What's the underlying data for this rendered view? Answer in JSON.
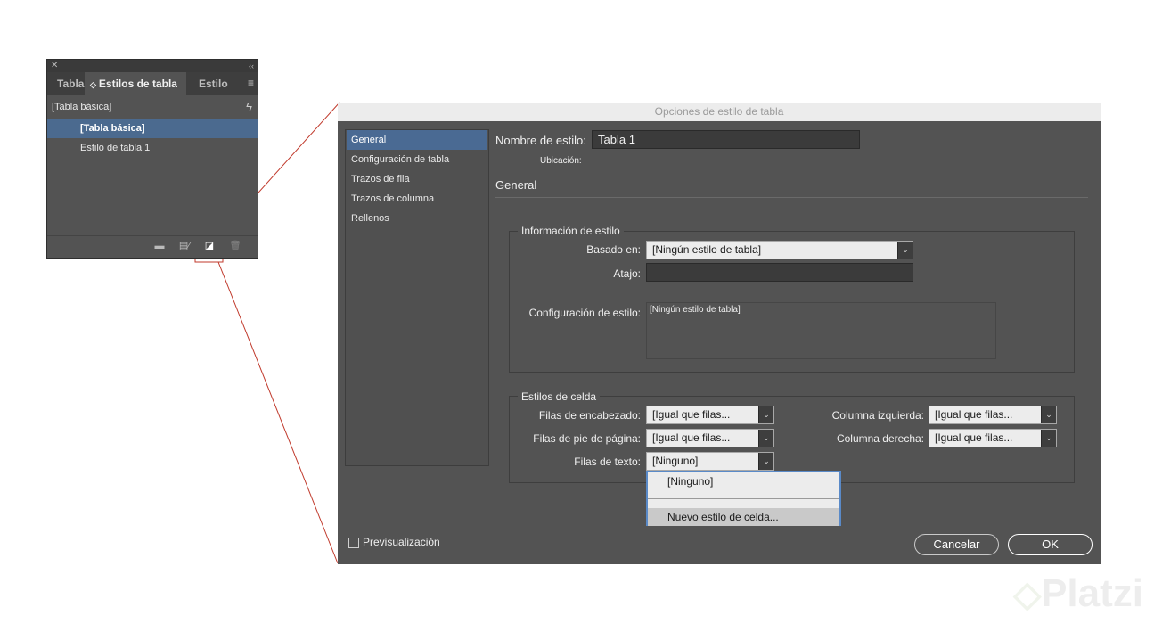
{
  "panel": {
    "tabs": [
      "Tabla",
      "Estilos de tabla",
      "Estilo"
    ],
    "active_tab_marker": "◇",
    "current_style": "[Tabla básica]",
    "styles": [
      "[Tabla básica]",
      "Estilo de tabla 1"
    ]
  },
  "dialog": {
    "title": "Opciones de estilo de tabla",
    "sidebar": [
      "General",
      "Configuración de tabla",
      "Trazos de fila",
      "Trazos de columna",
      "Rellenos"
    ],
    "style_name_label": "Nombre de estilo:",
    "style_name_value": "Tabla 1",
    "location_label": "Ubicación:",
    "section_title": "General",
    "style_info": {
      "title": "Información de estilo",
      "based_on_label": "Basado en:",
      "based_on_value": "[Ningún estilo de tabla]",
      "shortcut_label": "Atajo:",
      "shortcut_value": "",
      "config_label": "Configuración de estilo:",
      "config_value": "[Ningún estilo de tabla]"
    },
    "cell_styles": {
      "title": "Estilos de celda",
      "header_rows_label": "Filas de encabezado:",
      "header_rows_value": "[Igual que filas...",
      "footer_rows_label": "Filas de pie de página:",
      "footer_rows_value": "[Igual que filas...",
      "body_rows_label": "Filas de texto:",
      "body_rows_value": "[Ninguno]",
      "left_col_label": "Columna izquierda:",
      "left_col_value": "[Igual que filas...",
      "right_col_label": "Columna derecha:",
      "right_col_value": "[Igual que filas..."
    },
    "dropdown": {
      "items": [
        "[Ninguno]",
        "Nuevo estilo de celda..."
      ]
    },
    "preview_label": "Previsualización",
    "cancel_label": "Cancelar",
    "ok_label": "OK"
  },
  "watermark": "Platzi",
  "colors": {
    "callout_line": "#c0392b",
    "selection": "#4a6a93",
    "popup_border": "#5a8ac8"
  }
}
